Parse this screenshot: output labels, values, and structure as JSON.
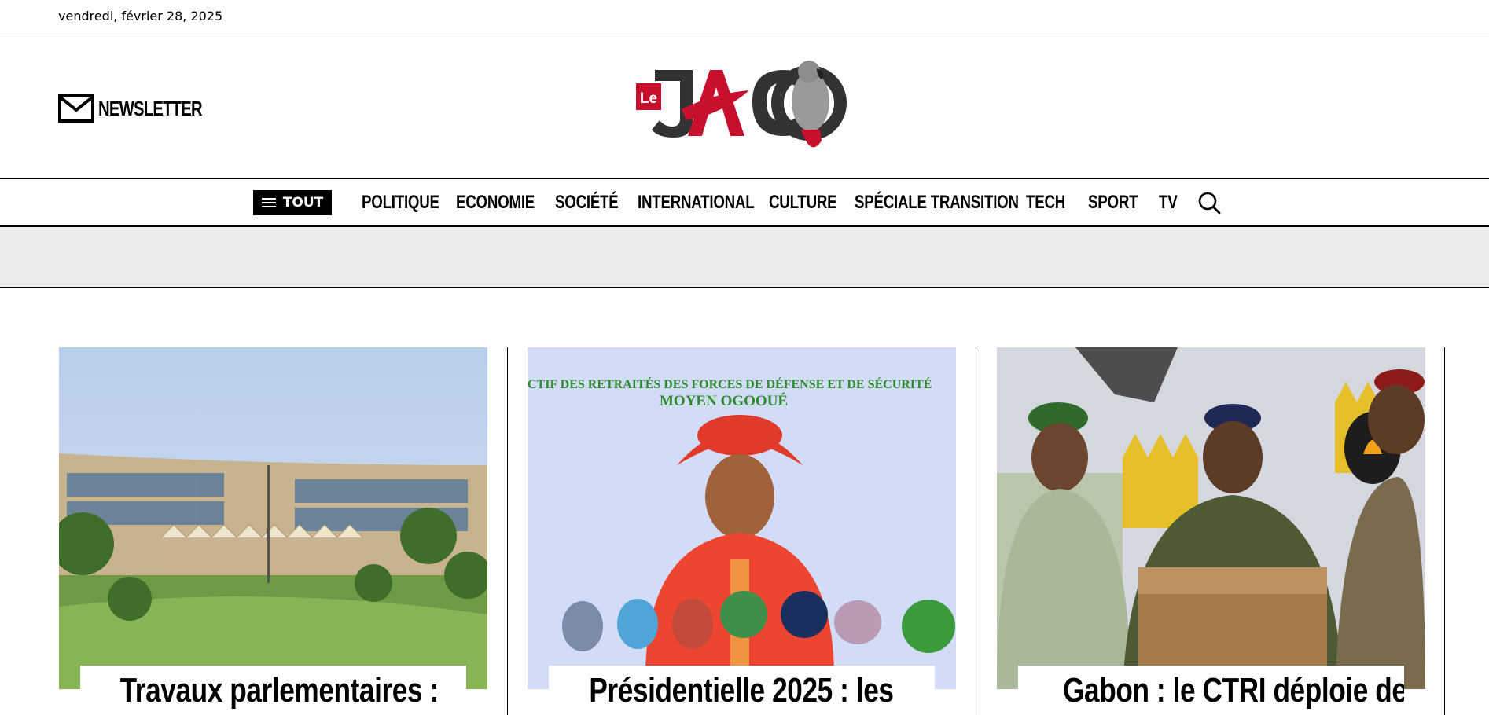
{
  "topbar": {
    "date": "vendredi, février 28, 2025"
  },
  "header": {
    "newsletter_label": "NEWSLETTER",
    "logo": {
      "prefix": "Le",
      "name": "JACO",
      "mascot": "parrot-icon"
    }
  },
  "nav": {
    "all_label": "TOUT",
    "items": [
      {
        "label": "POLITIQUE"
      },
      {
        "label": "ECONOMIE"
      },
      {
        "label": "SOCIÉTÉ"
      },
      {
        "label": "INTERNATIONAL"
      },
      {
        "label": "CULTURE"
      },
      {
        "label": "SPÉCIALE TRANSITION"
      },
      {
        "label": "TECH"
      },
      {
        "label": "SPORT"
      },
      {
        "label": "TV"
      }
    ],
    "search_icon": "search-icon"
  },
  "articles": [
    {
      "title": "Travaux parlementaires :",
      "image": "parliament-building-photo"
    },
    {
      "title": "Présidentielle 2025 : les",
      "image": "general-portrait-banner-photo",
      "banner_text": "CTIF DES RETRAITÉS DES FORCES DE DÉFENSE ET DE SÉCURITÉ",
      "banner_subtext": "MOYEN OGOOUÉ"
    },
    {
      "title": "Gabon : le CTRI déploie des",
      "image": "military-officers-podium-photo"
    }
  ],
  "colors": {
    "brand_red": "#c8102e",
    "text": "#000000",
    "band_gray": "#ececec"
  }
}
